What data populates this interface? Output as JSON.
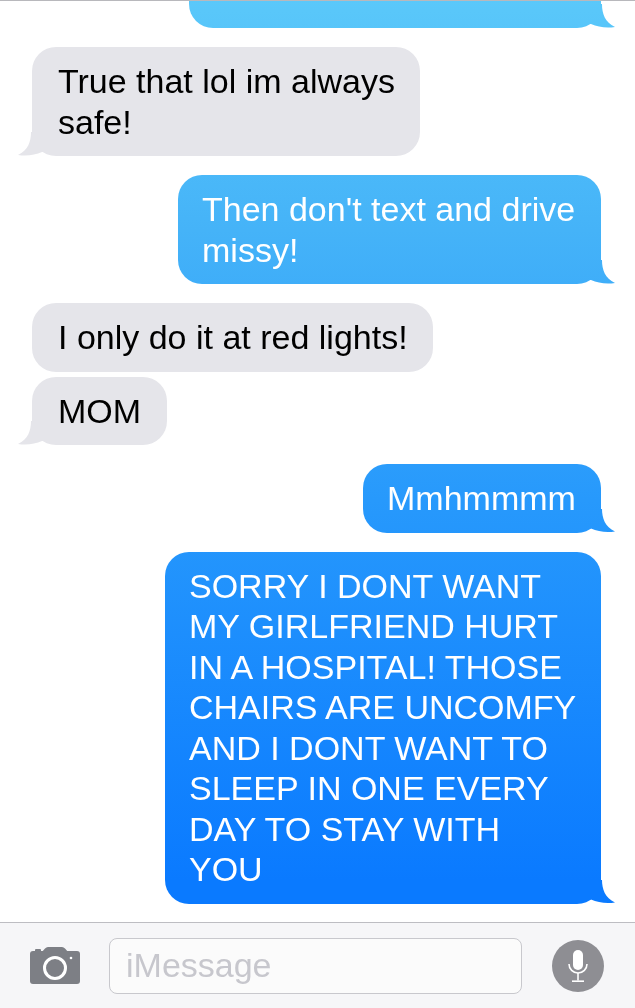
{
  "messages": [
    {
      "kind": "sent",
      "clipped_top": true,
      "tail": true
    },
    {
      "kind": "received",
      "text": "True that lol im always safe!",
      "tail": true
    },
    {
      "kind": "sent",
      "text": "Then don't text and drive missy!",
      "tail": true
    },
    {
      "kind": "received",
      "text": "I only do it at red lights!",
      "tail": false
    },
    {
      "kind": "received",
      "text": "MOM",
      "tail": true
    },
    {
      "kind": "sent",
      "text": "Mmhmmmm",
      "tail": true
    },
    {
      "kind": "sent",
      "text": "SORRY I DONT WANT MY GIRLFRIEND HURT IN A HOSPITAL! THOSE CHAIRS ARE UNCOMFY AND I DONT WANT TO SLEEP IN ONE EVERY DAY TO STAY WITH YOU",
      "tail": true
    }
  ],
  "composer": {
    "placeholder": "iMessage"
  }
}
